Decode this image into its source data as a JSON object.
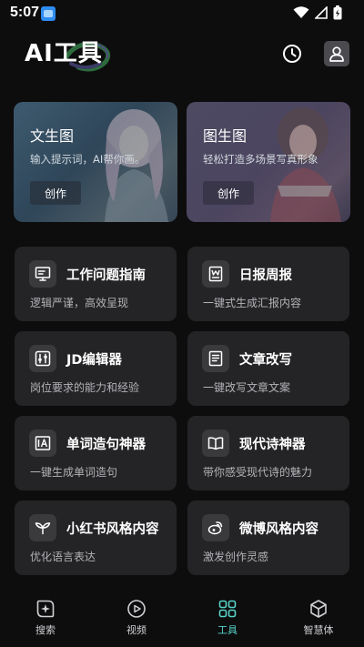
{
  "status_bar": {
    "time": "5:07"
  },
  "header": {
    "title": "AI工具"
  },
  "hero_cards": [
    {
      "title": "文生图",
      "subtitle": "输入提示词，AI帮你画。",
      "button": "创作"
    },
    {
      "title": "图生图",
      "subtitle": "轻松打造多场景写真形象",
      "button": "创作"
    }
  ],
  "tools": [
    {
      "title": "工作问题指南",
      "desc": "逻辑严谨，高效呈现",
      "icon": "presentation-icon"
    },
    {
      "title": "日报周报",
      "desc": "一键式生成汇报内容",
      "icon": "word-doc-icon"
    },
    {
      "title": "JD编辑器",
      "desc": "岗位要求的能力和经验",
      "icon": "sliders-icon"
    },
    {
      "title": "文章改写",
      "desc": "一键改写文章文案",
      "icon": "document-icon"
    },
    {
      "title": "单词造句神器",
      "desc": "一键生成单词造句",
      "icon": "text-card-icon"
    },
    {
      "title": "现代诗神器",
      "desc": "带你感受现代诗的魅力",
      "icon": "book-icon"
    },
    {
      "title": "小红书风格内容",
      "desc": "优化语言表达",
      "icon": "sprout-icon"
    },
    {
      "title": "微博风格内容",
      "desc": "激发创作灵感",
      "icon": "weibo-icon"
    }
  ],
  "bottom_nav": [
    {
      "label": "搜索",
      "icon": "sparkle-search-icon",
      "active": false
    },
    {
      "label": "视频",
      "icon": "play-circle-icon",
      "active": false
    },
    {
      "label": "工具",
      "icon": "grid-icon",
      "active": true
    },
    {
      "label": "智慧体",
      "icon": "cube-icon",
      "active": false
    }
  ],
  "colors": {
    "background": "#0d0d0e",
    "card": "#242426",
    "accent": "#57d3c8"
  }
}
